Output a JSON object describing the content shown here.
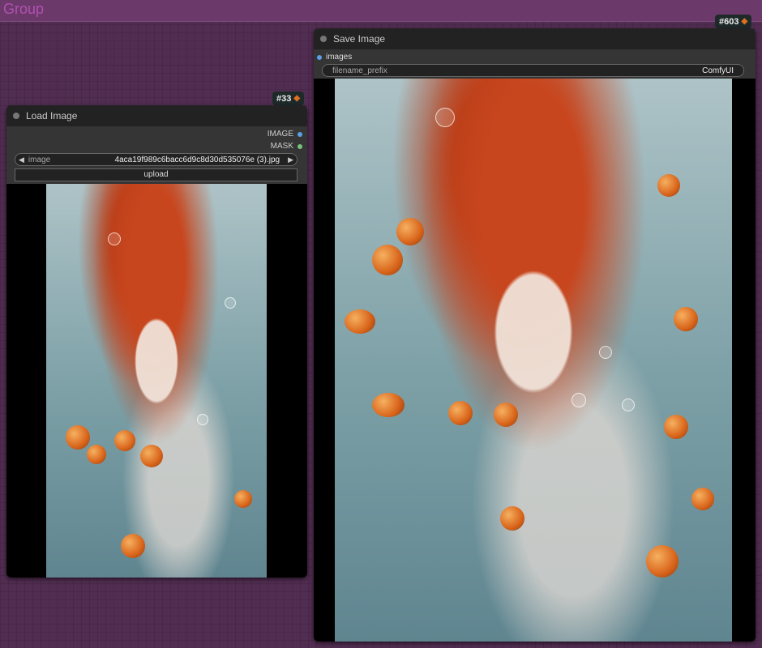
{
  "group": {
    "title": "Group"
  },
  "load_node": {
    "title": "Load Image",
    "id_badge": "#33",
    "outputs": [
      {
        "label": "IMAGE",
        "color": "#5aa0e8"
      },
      {
        "label": "MASK",
        "color": "#7ac27a"
      }
    ],
    "image_widget": {
      "label": "image",
      "value": "4aca19f989c6bacc6d9c8d30d535076e (3).jpg"
    },
    "upload_label": "upload",
    "preview_icon": "image-preview"
  },
  "save_node": {
    "title": "Save Image",
    "id_badge": "#603",
    "input_label": "images",
    "input_color": "#5aa0e8",
    "filename_widget": {
      "label": "filename_prefix",
      "value": "ComfyUI"
    },
    "preview_icon": "image-preview"
  },
  "icons": {
    "badge": "fox-icon",
    "arrow_left": "arrow-left-icon",
    "arrow_right": "arrow-right-icon"
  },
  "colors": {
    "canvas": "#522d52",
    "group": "#6b3a6b",
    "group_title": "#b24fb2",
    "node": "#353535",
    "header": "#222222"
  }
}
